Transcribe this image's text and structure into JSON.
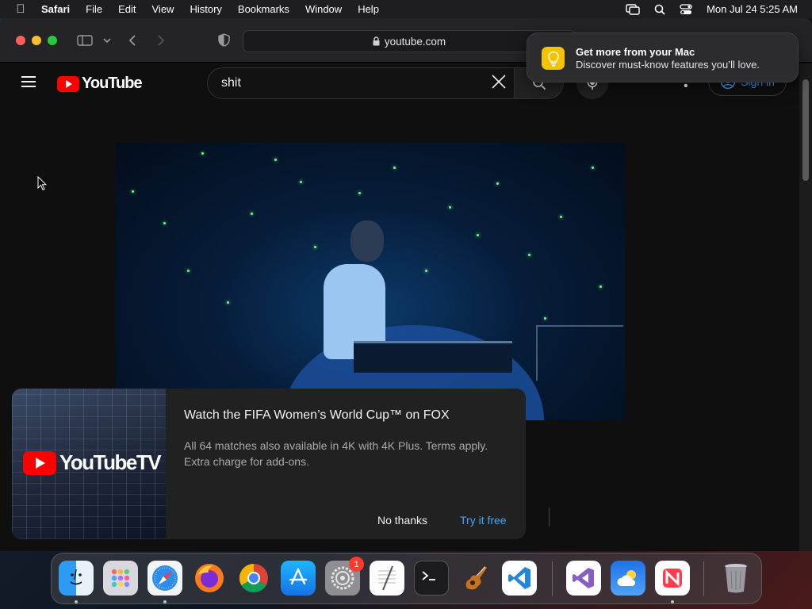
{
  "menubar": {
    "app_name": "Safari",
    "items": [
      "File",
      "Edit",
      "View",
      "History",
      "Bookmarks",
      "Window",
      "Help"
    ],
    "clock": "Mon Jul 24  5:25 AM"
  },
  "browser": {
    "url": "youtube.com"
  },
  "notification": {
    "title": "Get more from your Mac",
    "body": "Discover must-know features you’ll love."
  },
  "youtube": {
    "logo_text": "YouTube",
    "search_value": "shit",
    "signin_label": "Sign in"
  },
  "promo": {
    "brand_text": "YouTubeTV",
    "title": "Watch the FIFA Women’s World Cup™ on FOX",
    "body": "All 64 matches also available in 4K with 4K Plus. Terms apply. Extra charge for add-ons.",
    "dismiss_label": "No thanks",
    "cta_label": "Try it free"
  },
  "dock": {
    "apps": [
      "Finder",
      "Launchpad",
      "Safari",
      "Firefox",
      "Chrome",
      "App Store",
      "System Settings",
      "TextEdit",
      "Terminal",
      "GarageBand",
      "Visual Studio Code",
      "Visual Studio",
      "Weather",
      "News",
      "Trash"
    ],
    "settings_badge": "1"
  },
  "colors": {
    "accent": "#3ea6ff",
    "brand": "#ff0000"
  }
}
